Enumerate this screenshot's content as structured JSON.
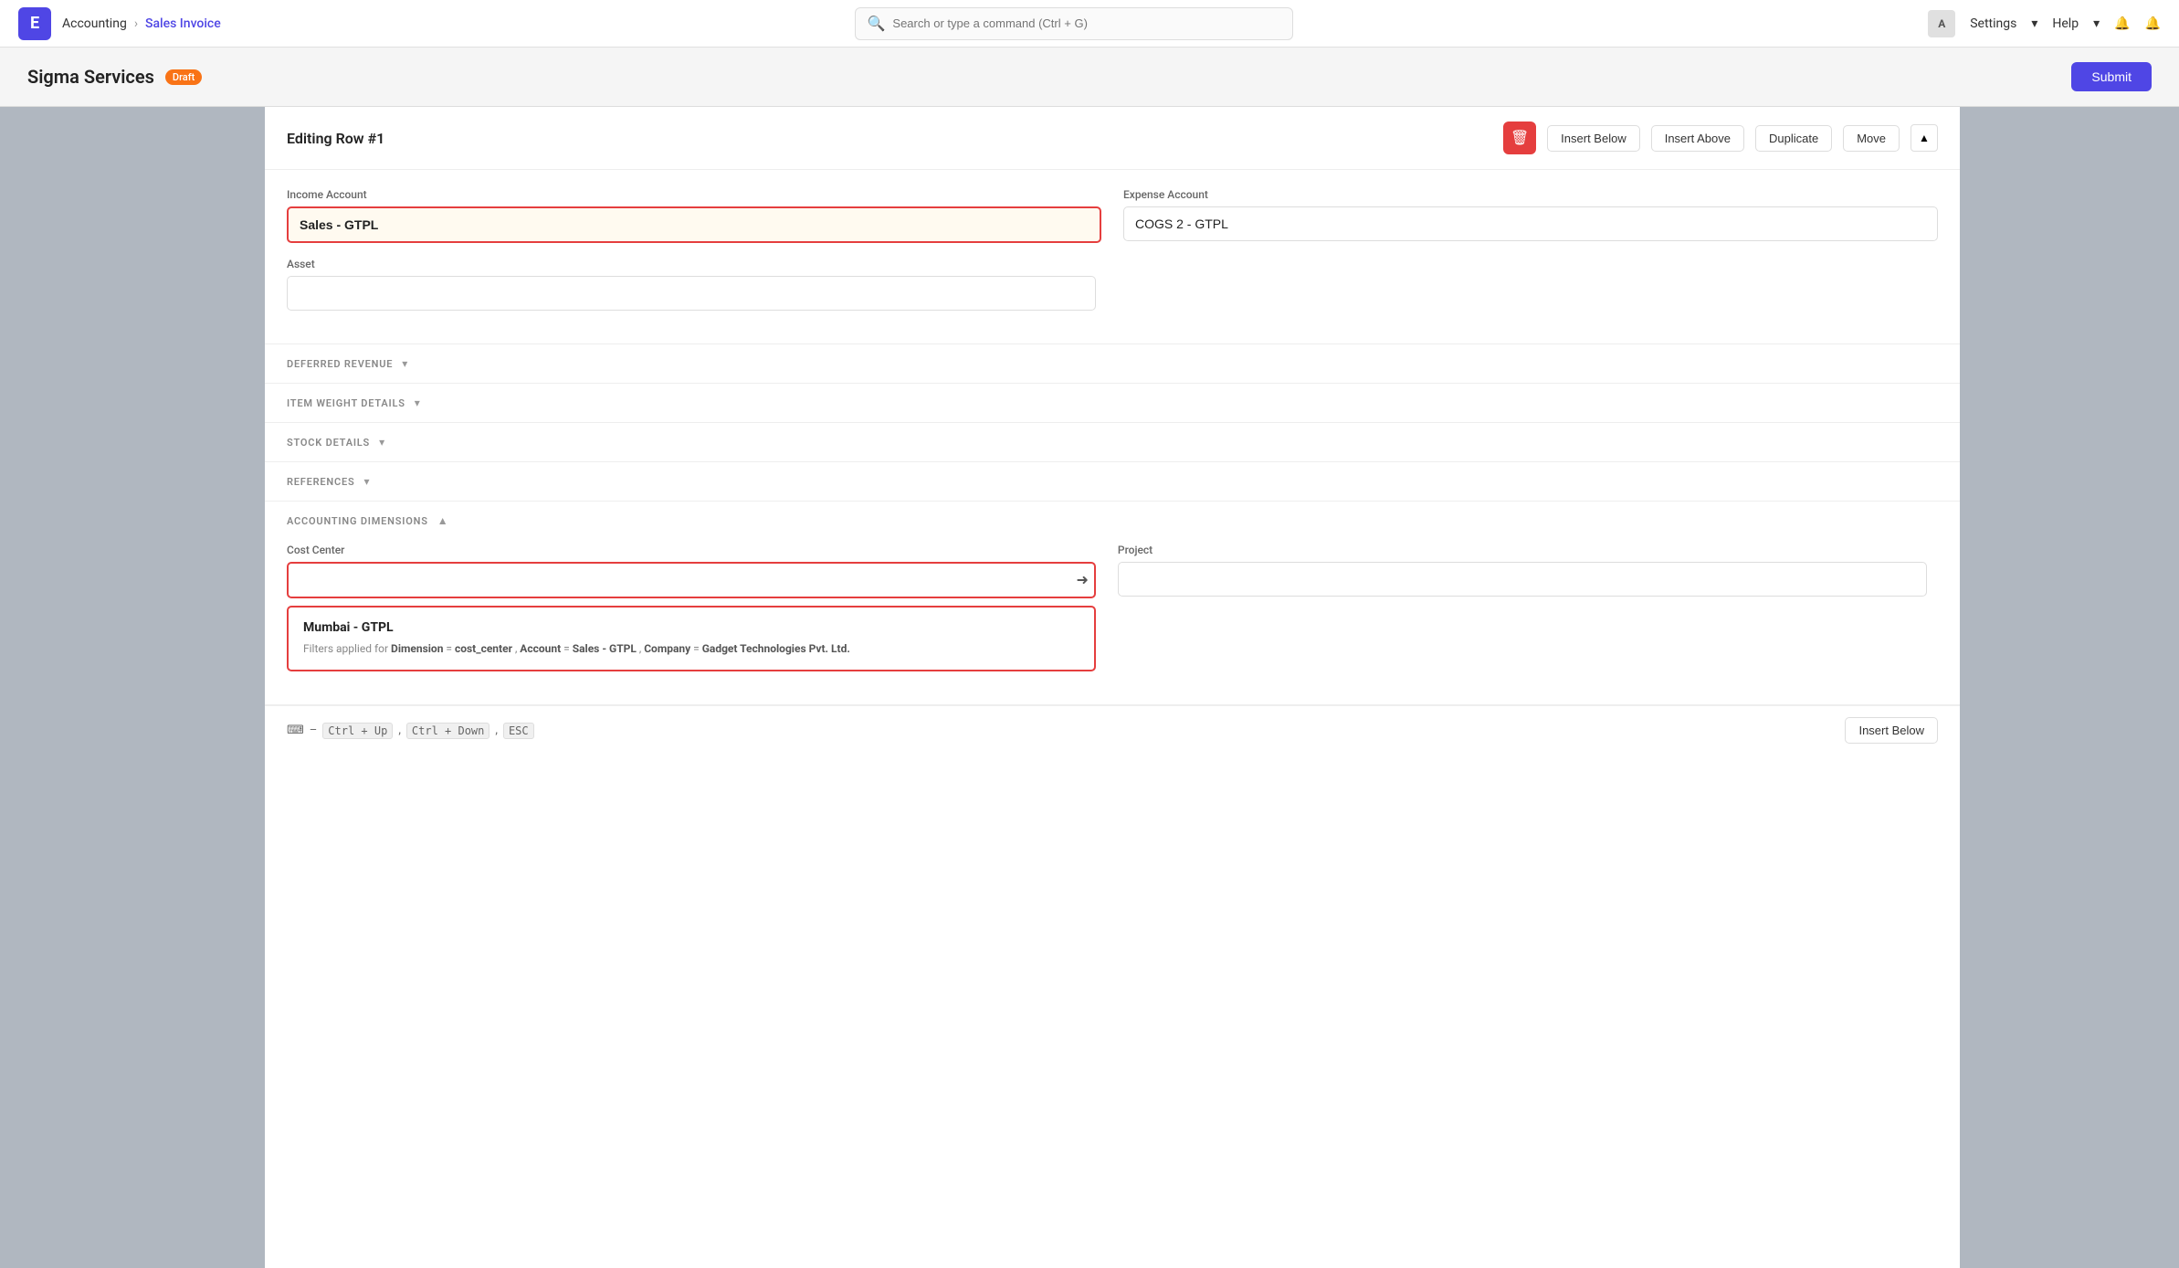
{
  "app": {
    "logo": "E",
    "nav": {
      "breadcrumb": [
        "Accounting",
        "Sales Invoice"
      ],
      "search_placeholder": "Search or type a command (Ctrl + G)",
      "settings_label": "Settings",
      "help_label": "Help",
      "avatar_letter": "A"
    }
  },
  "page": {
    "title": "Sigma Services",
    "draft_badge": "Draft",
    "submit_button": "Submit"
  },
  "panel": {
    "title": "Editing Row #1",
    "actions": {
      "insert_below": "Insert Below",
      "insert_above": "Insert Above",
      "duplicate": "Duplicate",
      "move": "Move"
    }
  },
  "form": {
    "income_account_label": "Income Account",
    "income_account_value": "Sales - GTPL",
    "expense_account_label": "Expense Account",
    "expense_account_value": "COGS 2 - GTPL",
    "asset_label": "Asset",
    "asset_value": ""
  },
  "sections": {
    "deferred_revenue": "DEFERRED REVENUE",
    "item_weight_details": "ITEM WEIGHT DETAILS",
    "stock_details": "STOCK DETAILS",
    "references": "REFERENCES",
    "accounting_dimensions": "ACCOUNTING DIMENSIONS"
  },
  "accounting": {
    "cost_center_label": "Cost Center",
    "cost_center_value": "",
    "project_label": "Project",
    "project_value": "",
    "dropdown": {
      "name": "Mumbai - GTPL",
      "filters_label": "Filters applied for",
      "dimension_label": "Dimension",
      "dimension_value": "cost_center",
      "account_label": "Account",
      "account_value": "Sales - GTPL",
      "company_label": "Company",
      "company_value": "Gadget Technologies Pvt. Ltd."
    }
  },
  "bottom_bar": {
    "keyboard_icon": "⌨",
    "dash": "–",
    "ctrl_up": "Ctrl + Up",
    "comma1": ",",
    "ctrl_down": "Ctrl + Down",
    "comma2": ",",
    "esc": "ESC",
    "insert_below": "Insert Below"
  }
}
